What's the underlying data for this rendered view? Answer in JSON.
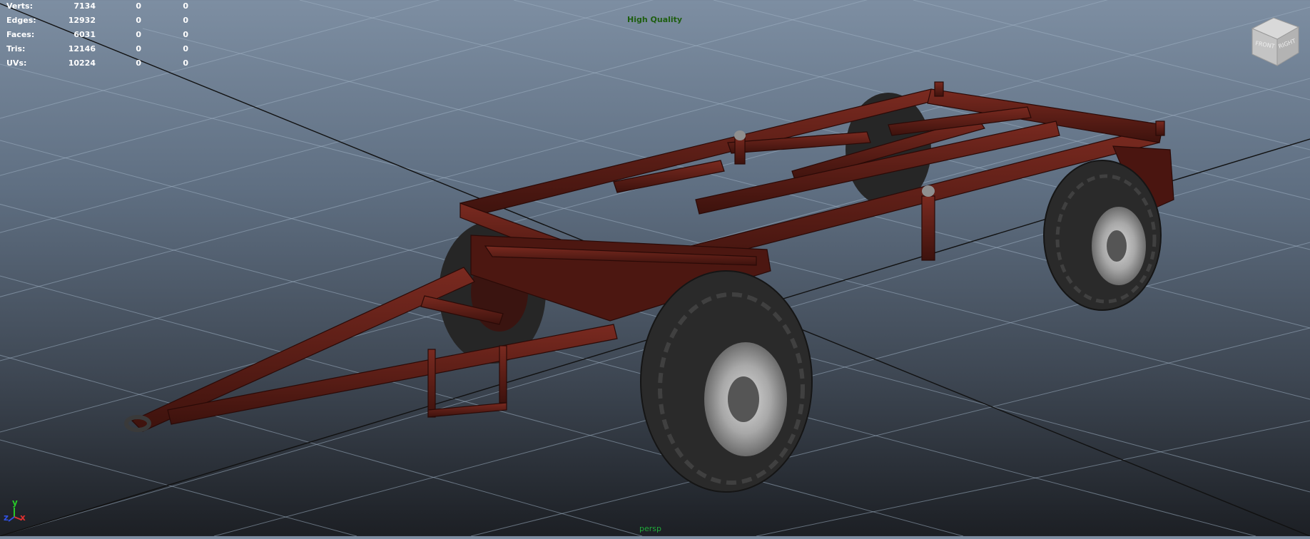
{
  "hud_stats": [
    {
      "label": "Verts:",
      "v1": "7134",
      "v2": "0",
      "v3": "0"
    },
    {
      "label": "Edges:",
      "v1": "12932",
      "v2": "0",
      "v3": "0"
    },
    {
      "label": "Faces:",
      "v1": "6031",
      "v2": "0",
      "v3": "0"
    },
    {
      "label": "Tris:",
      "v1": "12146",
      "v2": "0",
      "v3": "0"
    },
    {
      "label": "UVs:",
      "v1": "10224",
      "v2": "0",
      "v3": "0"
    }
  ],
  "render_mode": "High Quality",
  "camera_name": "persp",
  "view_cube": {
    "face_front": "FRONT",
    "face_right": "RIGHT"
  },
  "axis_gizmo": {
    "x": "x",
    "y": "y",
    "z": "z"
  },
  "colors": {
    "trailer_body": "#5a1c15",
    "tire": "#2b2b2b",
    "rim": "#b5b5b5",
    "hud_text": "#ffffff",
    "hq_text": "#1e5e10",
    "camera_text": "#20aa3a"
  }
}
